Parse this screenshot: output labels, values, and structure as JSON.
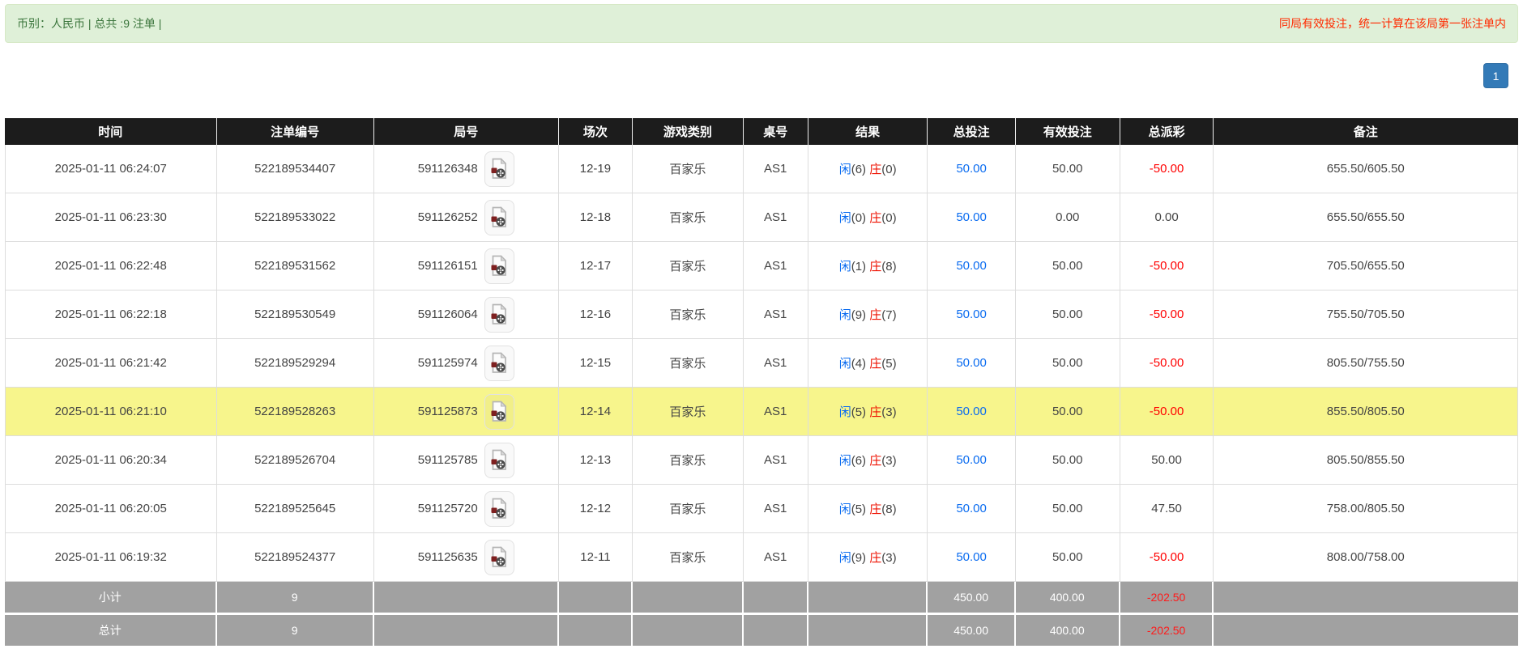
{
  "topbar": {
    "left_text": "币别：人民币 | 总共 :9 注单 |",
    "right_note": "同局有效投注，统一计算在该局第一张注单内"
  },
  "pagination": {
    "current_page": "1"
  },
  "table": {
    "columns": [
      "时间",
      "注单编号",
      "局号",
      "场次",
      "游戏类别",
      "桌号",
      "结果",
      "总投注",
      "有效投注",
      "总派彩",
      "备注"
    ],
    "result_labels": {
      "player": "闲",
      "banker": "庄"
    },
    "icons": {
      "round_cell_icon": "video-file-icon"
    },
    "rows": [
      {
        "time": "2025-01-11 06:24:07",
        "bet_id": "522189534407",
        "round_id": "591126348",
        "session": "12-19",
        "game_type": "百家乐",
        "table_no": "AS1",
        "player_pts": "(6)",
        "banker_pts": "(0)",
        "total_bet": "50.00",
        "valid_bet": "50.00",
        "payout": "-50.00",
        "remark": "655.50/605.50",
        "highlighted": false
      },
      {
        "time": "2025-01-11 06:23:30",
        "bet_id": "522189533022",
        "round_id": "591126252",
        "session": "12-18",
        "game_type": "百家乐",
        "table_no": "AS1",
        "player_pts": "(0)",
        "banker_pts": "(0)",
        "total_bet": "50.00",
        "valid_bet": "0.00",
        "payout": "0.00",
        "remark": "655.50/655.50",
        "highlighted": false
      },
      {
        "time": "2025-01-11 06:22:48",
        "bet_id": "522189531562",
        "round_id": "591126151",
        "session": "12-17",
        "game_type": "百家乐",
        "table_no": "AS1",
        "player_pts": "(1)",
        "banker_pts": "(8)",
        "total_bet": "50.00",
        "valid_bet": "50.00",
        "payout": "-50.00",
        "remark": "705.50/655.50",
        "highlighted": false
      },
      {
        "time": "2025-01-11 06:22:18",
        "bet_id": "522189530549",
        "round_id": "591126064",
        "session": "12-16",
        "game_type": "百家乐",
        "table_no": "AS1",
        "player_pts": "(9)",
        "banker_pts": "(7)",
        "total_bet": "50.00",
        "valid_bet": "50.00",
        "payout": "-50.00",
        "remark": "755.50/705.50",
        "highlighted": false
      },
      {
        "time": "2025-01-11 06:21:42",
        "bet_id": "522189529294",
        "round_id": "591125974",
        "session": "12-15",
        "game_type": "百家乐",
        "table_no": "AS1",
        "player_pts": "(4)",
        "banker_pts": "(5)",
        "total_bet": "50.00",
        "valid_bet": "50.00",
        "payout": "-50.00",
        "remark": "805.50/755.50",
        "highlighted": false
      },
      {
        "time": "2025-01-11 06:21:10",
        "bet_id": "522189528263",
        "round_id": "591125873",
        "session": "12-14",
        "game_type": "百家乐",
        "table_no": "AS1",
        "player_pts": "(5)",
        "banker_pts": "(3)",
        "total_bet": "50.00",
        "valid_bet": "50.00",
        "payout": "-50.00",
        "remark": "855.50/805.50",
        "highlighted": true
      },
      {
        "time": "2025-01-11 06:20:34",
        "bet_id": "522189526704",
        "round_id": "591125785",
        "session": "12-13",
        "game_type": "百家乐",
        "table_no": "AS1",
        "player_pts": "(6)",
        "banker_pts": "(3)",
        "total_bet": "50.00",
        "valid_bet": "50.00",
        "payout": "50.00",
        "remark": "805.50/855.50",
        "highlighted": false
      },
      {
        "time": "2025-01-11 06:20:05",
        "bet_id": "522189525645",
        "round_id": "591125720",
        "session": "12-12",
        "game_type": "百家乐",
        "table_no": "AS1",
        "player_pts": "(5)",
        "banker_pts": "(8)",
        "total_bet": "50.00",
        "valid_bet": "50.00",
        "payout": "47.50",
        "remark": "758.00/805.50",
        "highlighted": false
      },
      {
        "time": "2025-01-11 06:19:32",
        "bet_id": "522189524377",
        "round_id": "591125635",
        "session": "12-11",
        "game_type": "百家乐",
        "table_no": "AS1",
        "player_pts": "(9)",
        "banker_pts": "(3)",
        "total_bet": "50.00",
        "valid_bet": "50.00",
        "payout": "-50.00",
        "remark": "808.00/758.00",
        "highlighted": false
      }
    ],
    "footer_rows": [
      {
        "label": "小计",
        "count": "9",
        "round": "",
        "session": "",
        "game_type": "",
        "table_no": "",
        "result": "",
        "total_bet": "450.00",
        "valid_bet": "400.00",
        "payout": "-202.50",
        "remark": ""
      },
      {
        "label": "总计",
        "count": "9",
        "round": "",
        "session": "",
        "game_type": "",
        "table_no": "",
        "result": "",
        "total_bet": "450.00",
        "valid_bet": "400.00",
        "payout": "-202.50",
        "remark": ""
      }
    ]
  },
  "colors": {
    "topbar_bg": "#dff0d8",
    "topbar_text": "#3c763d",
    "note_red": "#ff2a00",
    "pager_blue": "#337ab7",
    "header_bg": "#1c1c1c",
    "link_blue": "#0b6cf0",
    "player_blue": "#0b6cf0",
    "banker_red": "#ee1100",
    "negative_red": "#ff0000",
    "highlight_yellow": "#f7f58c",
    "footer_gray": "#a1a1a1"
  }
}
